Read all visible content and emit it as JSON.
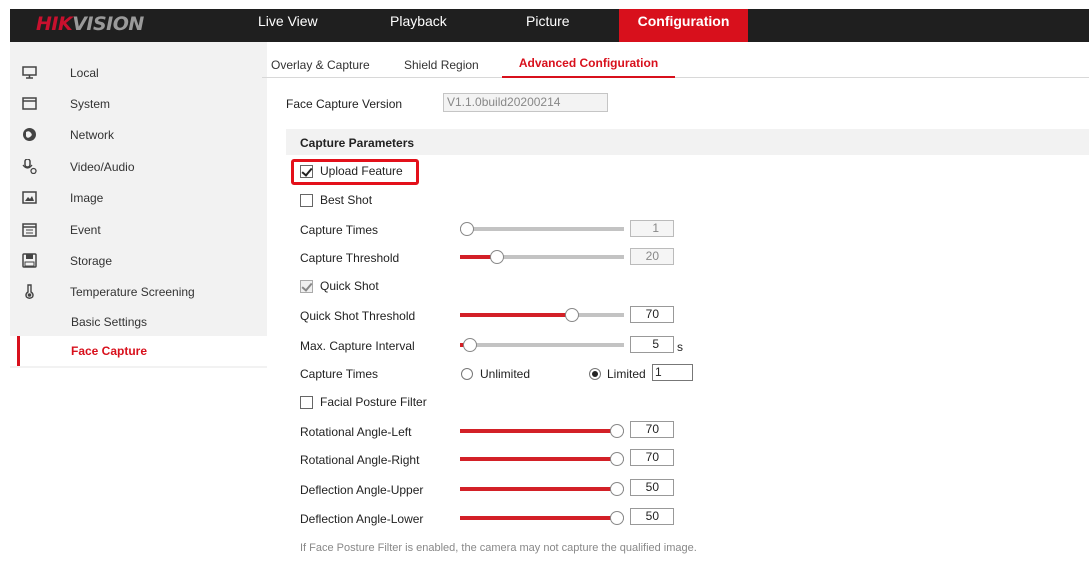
{
  "header": {
    "logo_part1": "HIK",
    "logo_part2": "VISION",
    "tabs": [
      {
        "label": "Live View"
      },
      {
        "label": "Playback"
      },
      {
        "label": "Picture"
      },
      {
        "label": "Configuration",
        "active": true
      }
    ]
  },
  "sidebar": {
    "items": [
      {
        "label": "Local",
        "icon": "monitor-icon"
      },
      {
        "label": "System",
        "icon": "window-icon"
      },
      {
        "label": "Network",
        "icon": "globe-icon"
      },
      {
        "label": "Video/Audio",
        "icon": "video-audio-icon"
      },
      {
        "label": "Image",
        "icon": "image-icon"
      },
      {
        "label": "Event",
        "icon": "calendar-icon"
      },
      {
        "label": "Storage",
        "icon": "storage-icon"
      },
      {
        "label": "Temperature Screening",
        "icon": "thermometer-icon"
      }
    ],
    "subitems": [
      {
        "label": "Basic Settings"
      },
      {
        "label": "Face Capture",
        "active": true
      }
    ]
  },
  "subtabs": [
    {
      "label": "Overlay & Capture"
    },
    {
      "label": "Shield Region"
    },
    {
      "label": "Advanced Configuration",
      "active": true
    }
  ],
  "version": {
    "label": "Face Capture Version",
    "value": "V1.1.0build20200214"
  },
  "section_title": "Capture Parameters",
  "options": {
    "upload_feature": {
      "label": "Upload Feature",
      "checked": true
    },
    "best_shot": {
      "label": "Best Shot",
      "checked": false
    },
    "quick_shot": {
      "label": "Quick Shot",
      "checked": true
    },
    "facial_posture_filter": {
      "label": "Facial Posture Filter",
      "checked": false
    }
  },
  "sliders": {
    "capture_times": {
      "label": "Capture Times",
      "value": "1",
      "level": 0.0,
      "disabled": true
    },
    "capture_threshold": {
      "label": "Capture Threshold",
      "value": "20",
      "level": 0.2,
      "disabled": true
    },
    "quick_shot_threshold": {
      "label": "Quick Shot Threshold",
      "value": "70",
      "level": 0.7
    },
    "max_capture_interval": {
      "label": "Max. Capture Interval",
      "value": "5",
      "unit": "s",
      "level": 0.02
    },
    "rot_left": {
      "label": "Rotational Angle-Left",
      "value": "70",
      "level": 1.0
    },
    "rot_right": {
      "label": "Rotational Angle-Right",
      "value": "70",
      "level": 1.0
    },
    "defl_upper": {
      "label": "Deflection Angle-Upper",
      "value": "50",
      "level": 1.0
    },
    "defl_lower": {
      "label": "Deflection Angle-Lower",
      "value": "50",
      "level": 1.0
    }
  },
  "capture_times_mode": {
    "label": "Capture Times",
    "unlimited": "Unlimited",
    "limited": "Limited",
    "limited_value": "1",
    "selected": "limited"
  },
  "note": "If Face Posture Filter is enabled, the camera may not capture the qualified image.",
  "colors": {
    "accent": "#d8101c",
    "topbar": "#1f1f1f",
    "slider_fill": "#d32027"
  }
}
